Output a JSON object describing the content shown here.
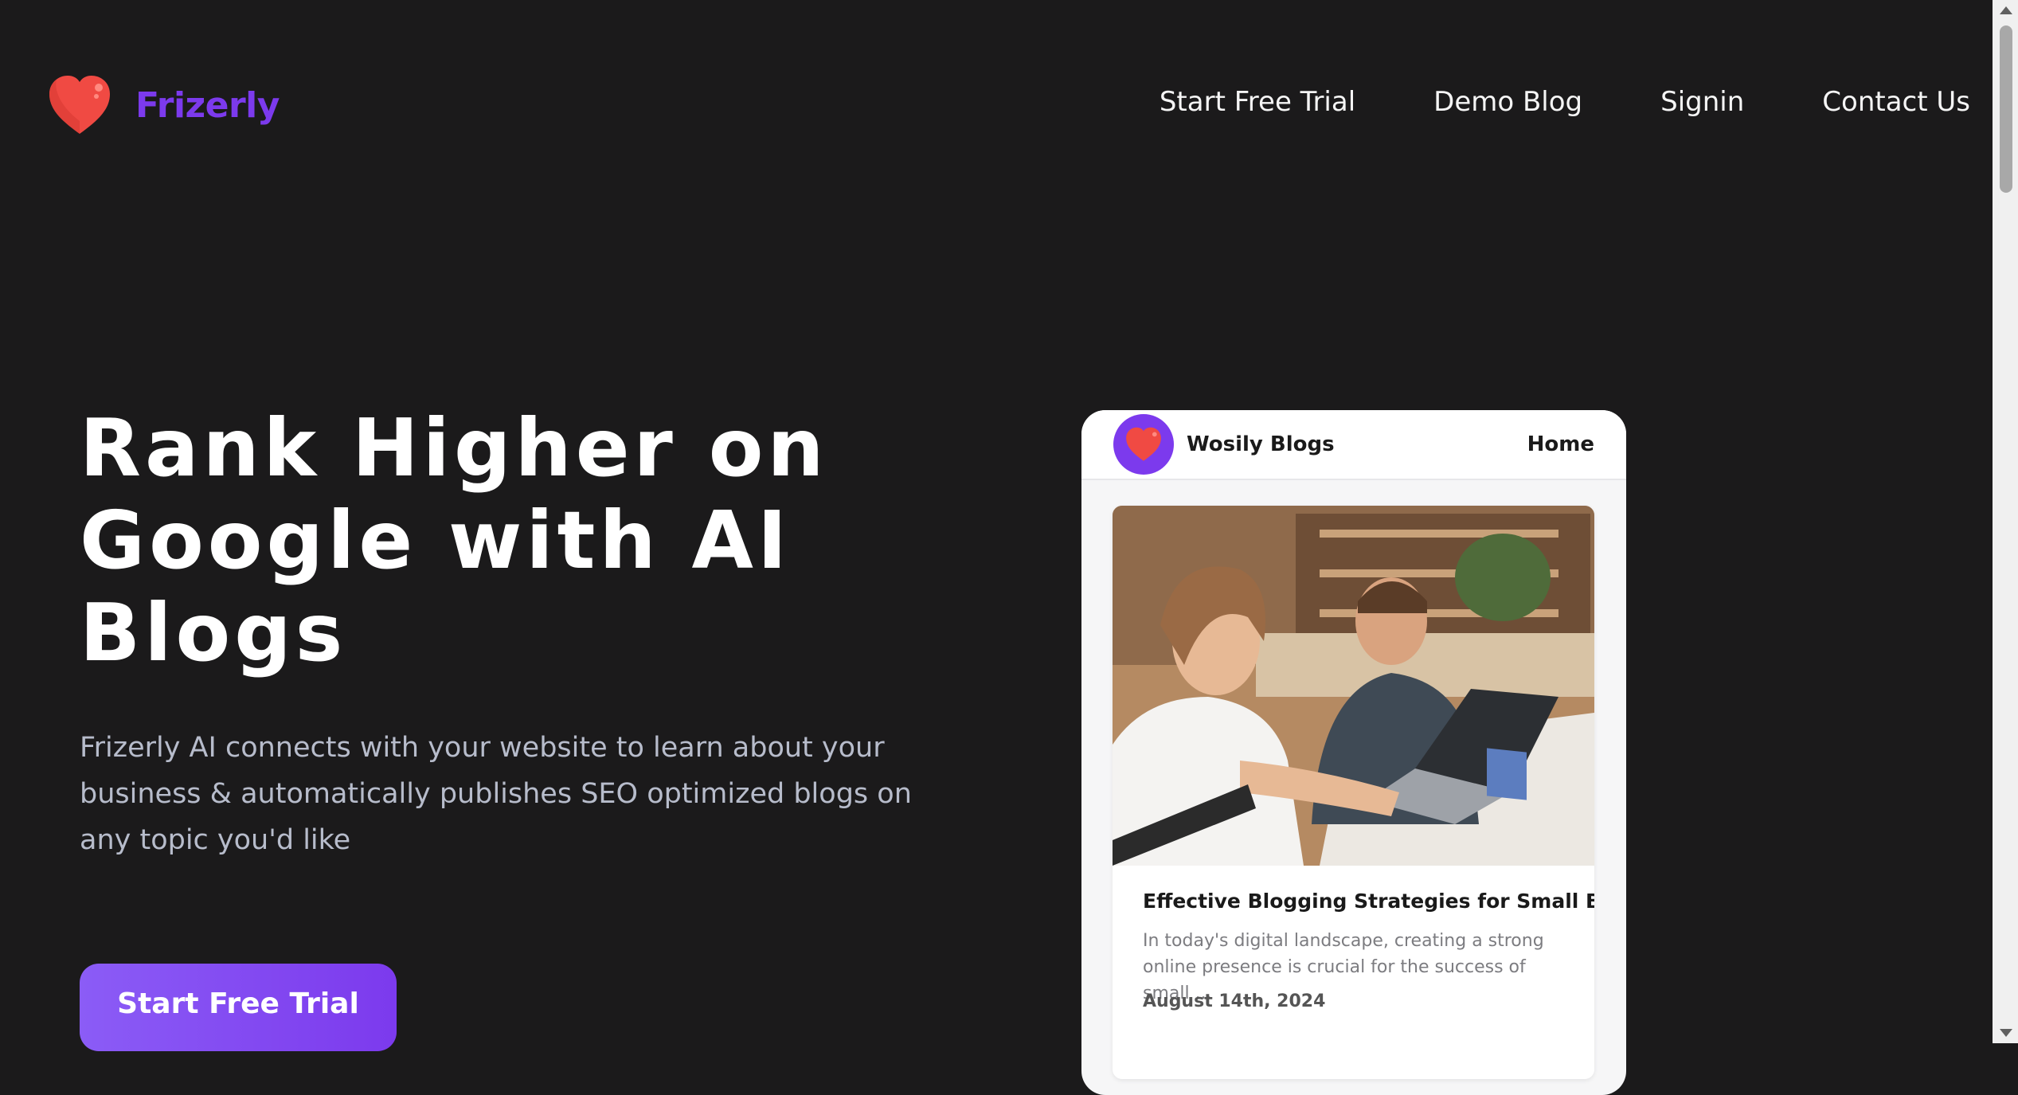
{
  "header": {
    "brand_name": "Frizerly",
    "nav": [
      {
        "label": "Start Free Trial"
      },
      {
        "label": "Demo Blog"
      },
      {
        "label": "Signin"
      },
      {
        "label": "Contact Us"
      }
    ]
  },
  "hero": {
    "title": "Rank Higher on Google with AI Blogs",
    "subtitle": "Frizerly AI connects with your website to learn about your business & automatically publishes SEO optimized blogs on any topic you'd like",
    "cta_label": "Start Free Trial"
  },
  "demo_card": {
    "blog_name": "Wosily Blogs",
    "home_label": "Home",
    "post": {
      "title": "Effective Blogging Strategies for Small Busi...",
      "excerpt": "In today's digital landscape, creating a strong online presence is crucial for the success of small ...",
      "date": "August 14th, 2024"
    }
  },
  "colors": {
    "background": "#1b1a1b",
    "brand": "#7c3aed",
    "heart": "#f04a43"
  }
}
